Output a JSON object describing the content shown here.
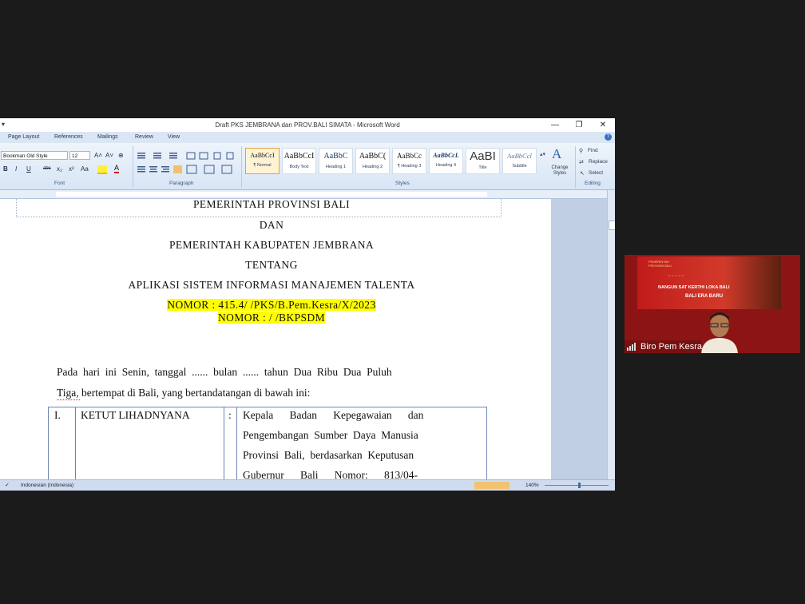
{
  "window": {
    "title": "Draft PKS JEMBRANA dan PROV.BALI SIMATA - Microsoft Word",
    "qa_glyph": "▾",
    "minimize": "—",
    "maximize": "❐",
    "close": "✕"
  },
  "tabs": [
    "Page Layout",
    "References",
    "Mailings",
    "Review",
    "View"
  ],
  "help_icon": "?",
  "ribbon": {
    "font_name": "Bookman Old Style",
    "font_size": "12",
    "groups": {
      "font": "Font",
      "paragraph": "Paragraph",
      "styles": "Styles",
      "editing": "Editing"
    },
    "font_buttons": [
      "A˄",
      "A˅",
      "⊕",
      "B",
      "I",
      "U",
      "abc",
      "x₂",
      "x²",
      "Aa"
    ],
    "styles": [
      {
        "preview": "AaBbCcI",
        "name": "¶ Normal"
      },
      {
        "preview": "AaBbCcI",
        "name": "Body Text"
      },
      {
        "preview": "AaBbC",
        "name": "Heading 1"
      },
      {
        "preview": "AaBbC(",
        "name": "Heading 2"
      },
      {
        "preview": "AaBbCc",
        "name": "¶ Heading 3"
      },
      {
        "preview": "AaBbCcL",
        "name": "Heading 4"
      },
      {
        "preview": "AaBI",
        "name": "Title"
      },
      {
        "preview": "AaBbCcl",
        "name": "Subtitle"
      }
    ],
    "change_styles": "Change Styles",
    "find": "Find",
    "replace": "Replace",
    "select": "Select"
  },
  "document": {
    "line0": "PEMERINTAH  PROVINSI BALI",
    "line1": "DAN",
    "line2": "PEMERINTAH  KABUPATEN  JEMBRANA",
    "line3": "TENTANG",
    "line4": "APLIKASI  SISTEM  INFORMASI  MANAJEMEN  TALENTA",
    "nomor1": "NOMOR : 415.4/   /PKS/B.Pem.Kesra/X/2023",
    "nomor2": "NOMOR :    /     /BKPSDM",
    "para1": "Pada  hari  ini  Senin,  tanggal  ......  bulan  ......  tahun  Dua  Ribu  Dua  Puluh",
    "para2": "Tiga, bertempat di Bali, yang bertandatangan di bawah ini:",
    "table": {
      "num": "I.",
      "name": "KETUT LIHADNYANA",
      "colon": ":",
      "desc": [
        "Kepala      Badan      Kepegawaian      dan",
        "Pengembangan  Sumber  Daya  Manusia",
        "Provinsi  Bali,  berdasarkan  Keputusan",
        "Gubernur      Bali      Nomor:      813/04-"
      ]
    }
  },
  "status": {
    "language": "Indonesian (Indonesia)",
    "zoom": "140%"
  },
  "video": {
    "participant": "Biro Pem Kesra",
    "banner_line1": "NANGUN SAT KERTHI LOKA BALI",
    "banner_line2": "BALI ERA BARU",
    "banner_top": "PEMERINTAH PROVINSI BALI"
  }
}
